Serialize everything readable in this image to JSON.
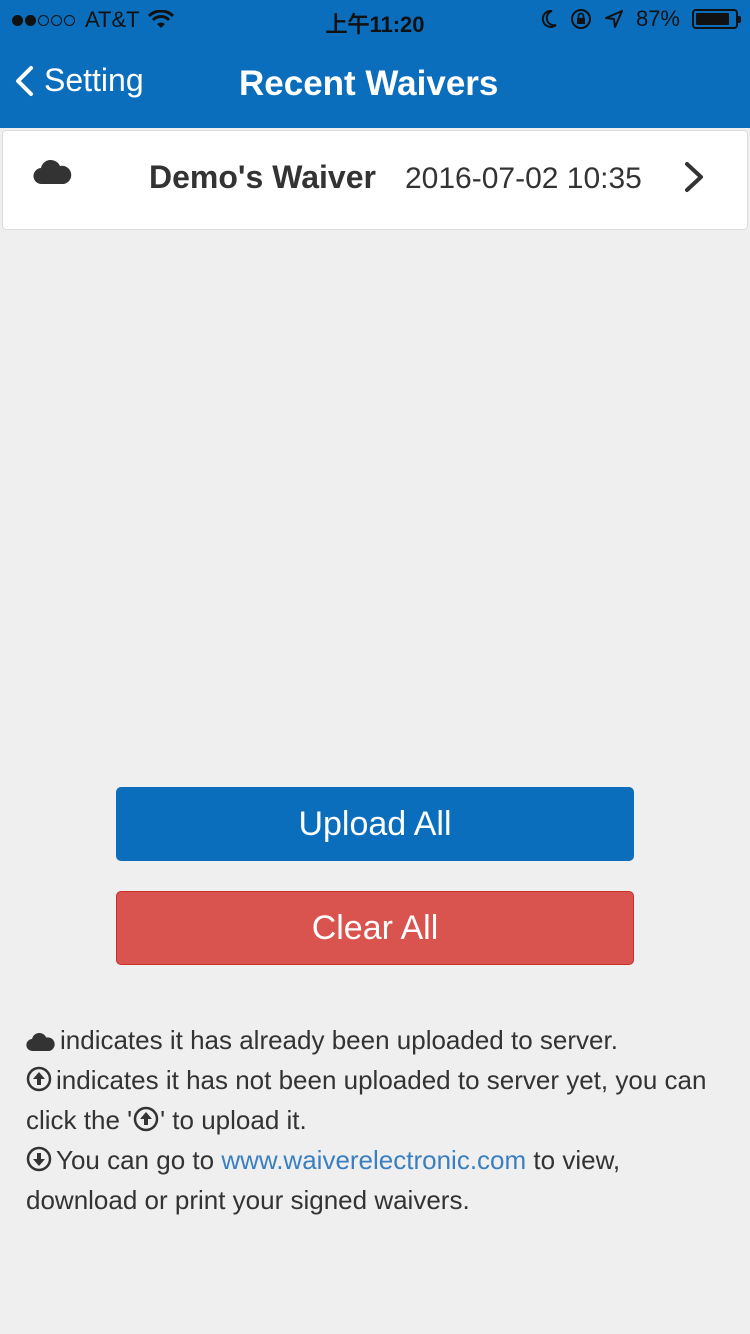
{
  "status_bar": {
    "carrier": "AT&T",
    "signal_filled": 2,
    "signal_total": 5,
    "time": "上午11:20",
    "battery_percent": "87%",
    "battery_level": 0.87
  },
  "nav": {
    "back_label": "Setting",
    "title": "Recent Waivers"
  },
  "waivers": [
    {
      "icon": "cloud-icon",
      "name": "Demo's Waiver",
      "date": "2016-07-02 10:35"
    }
  ],
  "buttons": {
    "upload_all": "Upload All",
    "clear_all": "Clear All"
  },
  "help": {
    "line1": "indicates it has already been uploaded to server.",
    "line2_a": "indicates it has not been uploaded to server yet, you can click the '",
    "line2_b": "' to upload it.",
    "line3_a": "You can go to",
    "line3_link": "www.waiverelectronic.com",
    "line3_b": "to view, download or print your signed waivers."
  },
  "colors": {
    "primary": "#0a6ebd",
    "danger": "#d9534f",
    "link": "#3a7fbf"
  }
}
